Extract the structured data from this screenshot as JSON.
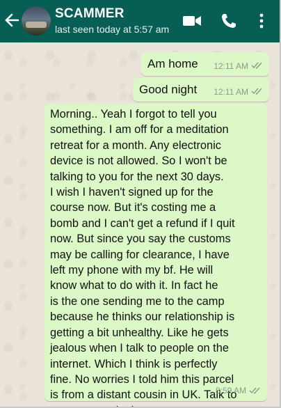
{
  "header": {
    "contact_name": "SCAMMER",
    "status": "last seen today at 5:57 am",
    "icons": [
      "back-arrow-icon",
      "avatar",
      "video-call-icon",
      "phone-icon",
      "more-options-icon"
    ],
    "color": "#075e54"
  },
  "messages": [
    {
      "text": "Am home",
      "time": "12:11 AM",
      "direction": "outgoing"
    },
    {
      "text": "Good night",
      "time": "12:11 AM",
      "direction": "outgoing"
    },
    {
      "text": "Morning.. Yeah I forgot to tell you\nsomething. I am off for a meditation\nretreat for a month. Any electronic\ndevice is not allowed. So I won't be\ntalking to you for the next 30 days.\nI wish I haven't signed up for the\ncourse now. But it's costing me a\nbomb and I can't get a refund if I quit\nnow. But since you say the customs\nmay be calling for clearance, I have\nleft my phone with my bf. He will\nknow what to do with it. In fact he\nis the one sending me to the camp\nbecause he thinks our relationship is\ngetting a bit unhealthy. Like he gets\njealous when I talk to people on the\ninternet. Which I think is perfectly\nfine. No worries I told him this parcel\nis from a distant cousin in UK. Talk to\nyou soon and take care.",
      "time": "8:59 AM",
      "direction": "outgoing"
    }
  ],
  "colors": {
    "outgoing_bubble": "#dcf8c6",
    "chat_background": "#e9e3da"
  }
}
